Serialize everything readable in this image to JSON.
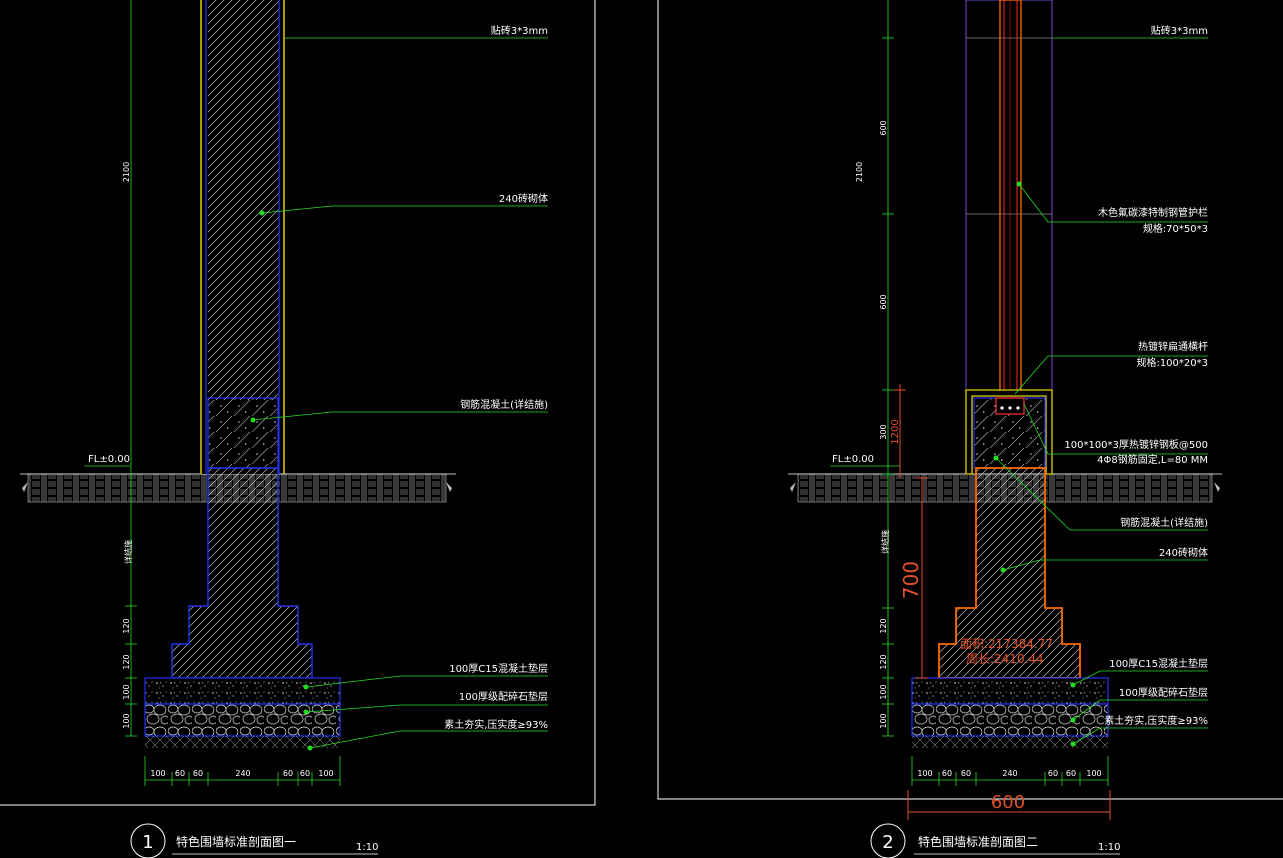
{
  "drawing1": {
    "labels": {
      "finish": "贴砖3*3mm",
      "brick": "240砖砌体",
      "ring_beam": "钢筋混凝土(详结施)",
      "fl": "FL±0.00",
      "cushion": "100厚C15混凝土垫层",
      "gravel": "100厚级配碎石垫层",
      "soil": "素土夯实,压实度≥93%",
      "see_struct": "详结施"
    },
    "vdims": {
      "h2100": "2100",
      "d120a": "120",
      "d120b": "120",
      "d100a": "100",
      "d100b": "100"
    },
    "hdims": [
      "100",
      "60",
      "60",
      "240",
      "60",
      "60",
      "100"
    ],
    "title": {
      "num": "1",
      "text": "特色围墙标准剖面图一",
      "scale": "1:10"
    }
  },
  "drawing2": {
    "labels": {
      "finish": "贴砖3*3mm",
      "steel_a": "木色氟碳漆特制钢管护栏",
      "steel_a_spec": "规格:70*50*3",
      "steel_b": "热镀锌扁通横杆",
      "steel_b_spec": "规格:100*20*3",
      "plate": "100*100*3厚热镀锌钢板@500",
      "anchor": "4Φ8钢筋固定,L=80 MM",
      "fl": "FL±0.00",
      "ring_beam": "钢筋混凝土(详结施)",
      "brick": "240砖砌体",
      "cushion": "100厚C15混凝土垫层",
      "gravel": "100厚级配碎石垫层",
      "soil": "素土夯实,压实度≥93%",
      "see_struct": "详结施"
    },
    "vdims": {
      "h2100": "2100",
      "h600a": "600",
      "h600b": "600",
      "h300": "300",
      "d120a": "120",
      "d120b": "120",
      "d100a": "100",
      "d100b": "100"
    },
    "red": {
      "h1200": "1200",
      "h700": "700",
      "area": "面积:217384.77",
      "perim": "周长:2410.44",
      "w600": "600"
    },
    "hdims": [
      "100",
      "60",
      "60",
      "240",
      "60",
      "60",
      "100"
    ],
    "title": {
      "num": "2",
      "text": "特色围墙标准剖面图二",
      "scale": "1:10"
    }
  }
}
